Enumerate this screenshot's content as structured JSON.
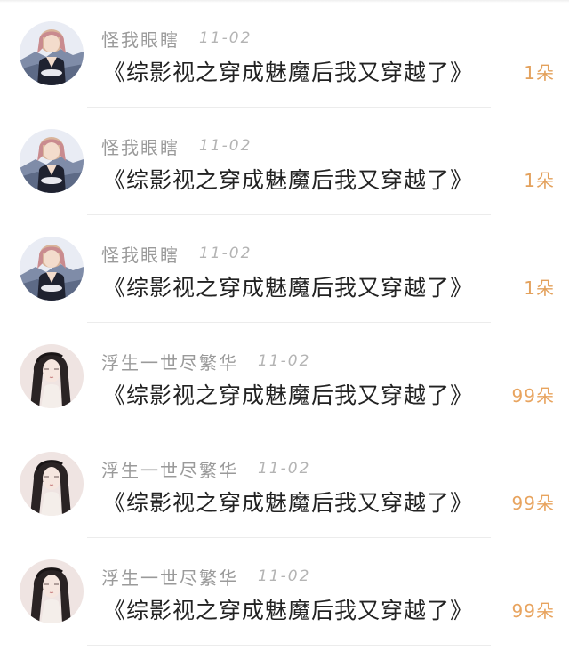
{
  "records": [
    {
      "avatar": "avatar-girl-blonde",
      "username": "怪我眼瞎",
      "date": "11-02",
      "book": "《综影视之穿成魅魔后我又穿越了》",
      "gift": "1朵"
    },
    {
      "avatar": "avatar-girl-blonde",
      "username": "怪我眼瞎",
      "date": "11-02",
      "book": "《综影视之穿成魅魔后我又穿越了》",
      "gift": "1朵"
    },
    {
      "avatar": "avatar-girl-blonde",
      "username": "怪我眼瞎",
      "date": "11-02",
      "book": "《综影视之穿成魅魔后我又穿越了》",
      "gift": "1朵"
    },
    {
      "avatar": "avatar-woman-black-hair",
      "username": "浮生一世尽繁华",
      "date": "11-02",
      "book": "《综影视之穿成魅魔后我又穿越了》",
      "gift": "99朵"
    },
    {
      "avatar": "avatar-woman-black-hair",
      "username": "浮生一世尽繁华",
      "date": "11-02",
      "book": "《综影视之穿成魅魔后我又穿越了》",
      "gift": "99朵"
    },
    {
      "avatar": "avatar-woman-black-hair",
      "username": "浮生一世尽繁华",
      "date": "11-02",
      "book": "《综影视之穿成魅魔后我又穿越了》",
      "gift": "99朵"
    }
  ]
}
